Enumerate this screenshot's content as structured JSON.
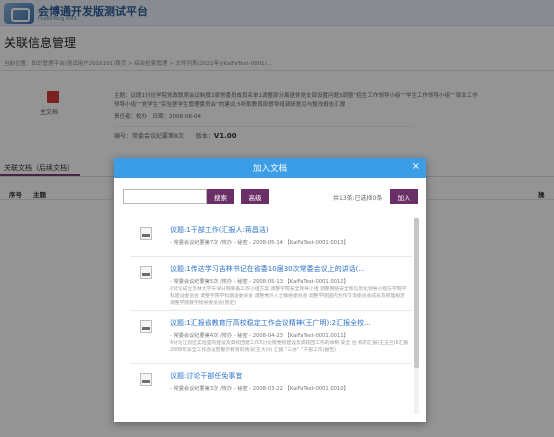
{
  "app": {
    "title": "会博通开发版测试平台",
    "subtitle": "HuiBoTong KMS"
  },
  "page": {
    "title": "关联信息管理",
    "breadcrumb": "当前位置：知识管理平台(测试用户2016101)首页 > 综合检索管理 > 文件列表(2021年)(KaiFaTest-0001)..."
  },
  "document": {
    "icon_label": "主文档",
    "summary_line1": "主题：议题1讨论学院党政联席会议制度2原常委员成员名单1调整部分离退休党支部设置问题3调整“招生工作领导小组”“学生工作领导小组”“就业工作",
    "summary_line2": "领导小组”“党学生”实验室学生管理委员会”的建议;5听取教育部督导组调研意见与整改报告汇报",
    "meta_line": "责任者：校办　日期：2008-06-04",
    "number_prefix": "编号：",
    "number_value": "常委会议纪要第8次",
    "version_prefix": "版本：",
    "version_value": "V1.00"
  },
  "tabs": {
    "related": "关联文档（后续文档）"
  },
  "table": {
    "col_index": "序号",
    "col_subject": "主题",
    "col_action": "操"
  },
  "modal": {
    "title": "加入文档",
    "close": "×",
    "search_value": "",
    "search_placeholder": "",
    "search_button": "搜索",
    "advanced_button": "高级",
    "count_text": "共13条,已选择0条",
    "add_button": "加入",
    "items": [
      {
        "title": "议题:1干部工作(汇报人:蒋昌洁)",
        "meta": "- 常委会议纪要第7次 /校办 - 秘密 - 2008-05-14 【KaiFaTest-0001.0013】",
        "desc": ""
      },
      {
        "title": "议题:1传达学习吉林书记在省委10届30次常委会议上的讲话(...",
        "meta": "- 常委会议纪要第5次 /校办 - 秘密 - 2008-05-13 【KaiFaTest-0001.0012】",
        "desc": "2讨论成立吉林大学天津分院筹备工作小组方案 调整学院安全领导小组 调整网络安全和信息化领导小组与学院学科建设委员会 调整学院学科建设委员会 调整党外人士联络委员会 调整学院国内合作交流委员会成员及管理规定 调整学院教学指导委员会(暂定)"
      },
      {
        "title": "议题:1汇报省教育厅高校稳定工作会议精神(王广明):2汇报全校...",
        "meta": "- 常委会议纪要第4次 /校办 - 秘密 - 2008-04-23 【KaiFaTest-0001.0011】",
        "desc": "4讨论江校区实验室的建设及高校团建工作5讨论院党校建设及高校团工作的体制 安全 位 校的汇报(王玉兰)6汇报2008年安全工作会议暨警示教育的情况(王大兴) 汇报 “三办” “干部工作(报告)"
      },
      {
        "title": "议题:讨论干部任免事宜",
        "meta": "- 常委会议纪要第3次 /校办 - 秘密 - 2008-03-22 【KaiFaTest-0001.0010】",
        "desc": ""
      }
    ]
  }
}
